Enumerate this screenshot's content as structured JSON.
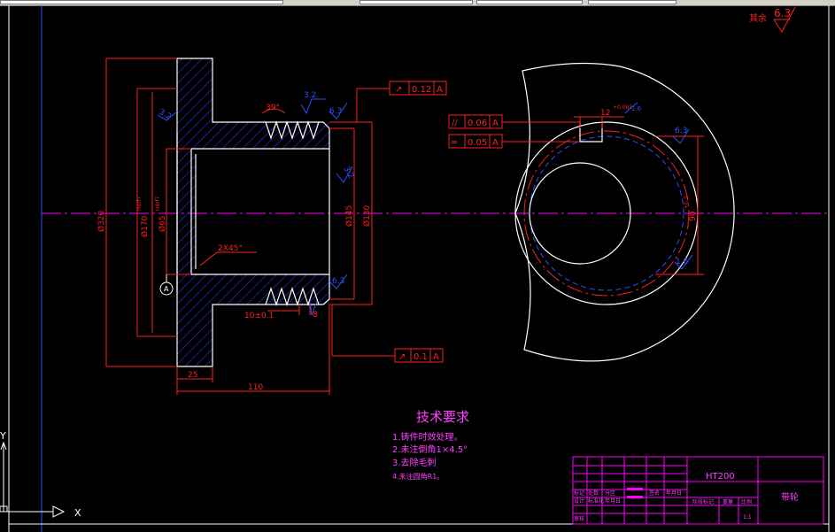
{
  "colors": {
    "background": "#000000",
    "part_outline": "#ffffff",
    "dimension": "#ff2020",
    "hatch": "#3030ff",
    "centerline": "#ff00ff",
    "title_block": "#ff00ff",
    "tech_notes": "#ff40ff",
    "border": "#ffffff"
  },
  "icons": {
    "ucs": "ucs-axis-icon",
    "roughness": "surface-roughness-icon",
    "datum": "datum-a-icon"
  },
  "roughness": {
    "corner_label": "其余",
    "corner_value": "6.3",
    "thread_top": "3.2",
    "flange_left": "3.2",
    "right_top": "6.3",
    "right_mid": "3.2",
    "right_bottom": "6.3",
    "key_right": "6.3",
    "key_bottom": "1.6",
    "key_top": "1.6"
  },
  "tolerance_frames": {
    "runout_top": {
      "symbol": "↗",
      "value": "0.12",
      "datum": "A"
    },
    "runout_bottom": {
      "symbol": "↗",
      "value": "0.1",
      "datum": "A"
    },
    "parallel": {
      "symbol": "//",
      "value": "0.06",
      "datum": "A"
    },
    "symmetry": {
      "symbol": "═",
      "value": "0.05",
      "datum": "A"
    }
  },
  "dimensions": {
    "outer_dia": "Ø320",
    "bore_a": "Ø170",
    "bore_a_tol": "H8/f7",
    "bore_b": "Ø65",
    "bore_b_tol": "H8/f7",
    "thread_angle": "39°",
    "chamfer": "2X45°",
    "groove_width": "10±0.1",
    "groove_depth": "8",
    "dia_145": "Ø145",
    "dia_130": "Ø130",
    "flange_width": "25",
    "length": "110",
    "key_width": "12",
    "key_width_tol": "+0.081",
    "key_depth": "90",
    "key_depth_tol": "+0.2"
  },
  "datum_label": "A",
  "tech_notes": {
    "title": "技术要求",
    "items": [
      "1.铸件时效处理。",
      "2.未注倒角1×4.5°",
      "3.去除毛刺",
      "4.未注圆角R1。"
    ]
  },
  "title_block": {
    "material": "HT200",
    "part_name": "带轮",
    "cells": [
      "标记",
      "处数",
      "分区",
      "更改文件号",
      "签名",
      "年月日",
      "设计",
      "标准化",
      "年月日",
      "阶段标记",
      "重量",
      "比例",
      "1:1",
      "审核",
      "工艺",
      "批准"
    ]
  },
  "ucs": {
    "x_label": "X",
    "y_label": "Y"
  }
}
